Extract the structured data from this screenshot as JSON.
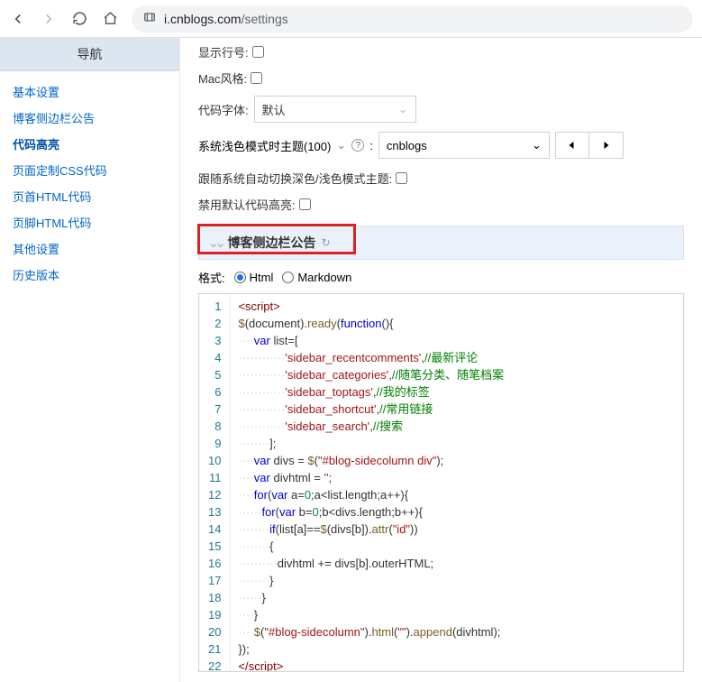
{
  "browser": {
    "host": "i.cnblogs.com",
    "path": "/settings"
  },
  "sidebar": {
    "header": "导航",
    "items": [
      {
        "label": "基本设置",
        "active": false
      },
      {
        "label": "博客侧边栏公告",
        "active": false
      },
      {
        "label": "代码高亮",
        "active": true
      },
      {
        "label": "页面定制CSS代码",
        "active": false
      },
      {
        "label": "页首HTML代码",
        "active": false
      },
      {
        "label": "页脚HTML代码",
        "active": false
      },
      {
        "label": "其他设置",
        "active": false
      },
      {
        "label": "历史版本",
        "active": false
      }
    ]
  },
  "settings": {
    "show_line_no": "显示行号:",
    "mac_style": "Mac风格:",
    "code_font": "代码字体:",
    "code_font_value": "默认",
    "theme_label": "系统浅色模式时主题(100)",
    "theme_value": "cnblogs",
    "follow_system": "跟随系统自动切换深色/浅色模式主题:",
    "disable_default_highlight": "禁用默认代码高亮:"
  },
  "section": {
    "title": "博客侧边栏公告"
  },
  "format": {
    "label": "格式:",
    "html": "Html",
    "markdown": "Markdown",
    "selected": "html"
  },
  "code": {
    "line_count": 22,
    "tokens": [
      [
        {
          "c": "tag",
          "t": "<script>"
        }
      ],
      [
        {
          "c": "fn",
          "t": "$"
        },
        {
          "c": "pun",
          "t": "("
        },
        {
          "c": "pun",
          "t": "document"
        },
        {
          "c": "pun",
          "t": ")."
        },
        {
          "c": "fn",
          "t": "ready"
        },
        {
          "c": "pun",
          "t": "("
        },
        {
          "c": "kw",
          "t": "function"
        },
        {
          "c": "pun",
          "t": "(){"
        }
      ],
      [
        {
          "c": "ws",
          "t": "····"
        },
        {
          "c": "kw",
          "t": "var"
        },
        {
          "c": "pun",
          "t": " list=["
        }
      ],
      [
        {
          "c": "ws",
          "t": "············"
        },
        {
          "c": "str",
          "t": "'sidebar_recentcomments'"
        },
        {
          "c": "pun",
          "t": ","
        },
        {
          "c": "cm",
          "t": "//最新评论"
        }
      ],
      [
        {
          "c": "ws",
          "t": "············"
        },
        {
          "c": "str",
          "t": "'sidebar_categories'"
        },
        {
          "c": "pun",
          "t": ","
        },
        {
          "c": "cm",
          "t": "//随笔分类、随笔档案"
        }
      ],
      [
        {
          "c": "ws",
          "t": "············"
        },
        {
          "c": "str",
          "t": "'sidebar_toptags'"
        },
        {
          "c": "pun",
          "t": ","
        },
        {
          "c": "cm",
          "t": "//我的标签"
        }
      ],
      [
        {
          "c": "ws",
          "t": "············"
        },
        {
          "c": "str",
          "t": "'sidebar_shortcut'"
        },
        {
          "c": "pun",
          "t": ","
        },
        {
          "c": "cm",
          "t": "//常用链接"
        }
      ],
      [
        {
          "c": "ws",
          "t": "············"
        },
        {
          "c": "str",
          "t": "'sidebar_search'"
        },
        {
          "c": "pun",
          "t": ","
        },
        {
          "c": "cm",
          "t": "//搜索"
        }
      ],
      [
        {
          "c": "ws",
          "t": "········"
        },
        {
          "c": "pun",
          "t": "];"
        }
      ],
      [
        {
          "c": "ws",
          "t": "····"
        },
        {
          "c": "kw",
          "t": "var"
        },
        {
          "c": "pun",
          "t": " divs = "
        },
        {
          "c": "fn",
          "t": "$"
        },
        {
          "c": "pun",
          "t": "("
        },
        {
          "c": "str",
          "t": "\"#blog-sidecolumn div\""
        },
        {
          "c": "pun",
          "t": ");"
        }
      ],
      [
        {
          "c": "ws",
          "t": "····"
        },
        {
          "c": "kw",
          "t": "var"
        },
        {
          "c": "pun",
          "t": " divhtml = "
        },
        {
          "c": "str",
          "t": "''"
        },
        {
          "c": "pun",
          "t": ";"
        }
      ],
      [
        {
          "c": "ws",
          "t": "····"
        },
        {
          "c": "kw",
          "t": "for"
        },
        {
          "c": "pun",
          "t": "("
        },
        {
          "c": "kw",
          "t": "var"
        },
        {
          "c": "pun",
          "t": " a="
        },
        {
          "c": "num",
          "t": "0"
        },
        {
          "c": "pun",
          "t": ";a<list.length;a++){"
        }
      ],
      [
        {
          "c": "ws",
          "t": "······"
        },
        {
          "c": "kw",
          "t": "for"
        },
        {
          "c": "pun",
          "t": "("
        },
        {
          "c": "kw",
          "t": "var"
        },
        {
          "c": "pun",
          "t": " b="
        },
        {
          "c": "num",
          "t": "0"
        },
        {
          "c": "pun",
          "t": ";b<divs.length;b++){"
        }
      ],
      [
        {
          "c": "ws",
          "t": "········"
        },
        {
          "c": "kw",
          "t": "if"
        },
        {
          "c": "pun",
          "t": "(list[a]=="
        },
        {
          "c": "fn",
          "t": "$"
        },
        {
          "c": "pun",
          "t": "(divs[b])."
        },
        {
          "c": "fn",
          "t": "attr"
        },
        {
          "c": "pun",
          "t": "("
        },
        {
          "c": "str",
          "t": "\"id\""
        },
        {
          "c": "pun",
          "t": "))"
        }
      ],
      [
        {
          "c": "ws",
          "t": "········"
        },
        {
          "c": "pun",
          "t": "{"
        }
      ],
      [
        {
          "c": "ws",
          "t": "··········"
        },
        {
          "c": "pun",
          "t": "divhtml += divs[b].outerHTML;"
        }
      ],
      [
        {
          "c": "ws",
          "t": "········"
        },
        {
          "c": "pun",
          "t": "}"
        }
      ],
      [
        {
          "c": "ws",
          "t": "······"
        },
        {
          "c": "pun",
          "t": "}"
        }
      ],
      [
        {
          "c": "ws",
          "t": "····"
        },
        {
          "c": "pun",
          "t": "}"
        }
      ],
      [
        {
          "c": "ws",
          "t": "····"
        },
        {
          "c": "fn",
          "t": "$"
        },
        {
          "c": "pun",
          "t": "("
        },
        {
          "c": "str",
          "t": "\"#blog-sidecolumn\""
        },
        {
          "c": "pun",
          "t": ")."
        },
        {
          "c": "fn",
          "t": "html"
        },
        {
          "c": "pun",
          "t": "("
        },
        {
          "c": "str",
          "t": "\"\""
        },
        {
          "c": "pun",
          "t": ")."
        },
        {
          "c": "fn",
          "t": "append"
        },
        {
          "c": "pun",
          "t": "(divhtml);"
        }
      ],
      [
        {
          "c": "pun",
          "t": "});"
        }
      ],
      [
        {
          "c": "tag",
          "t": "</"
        },
        {
          "c": "tag",
          "t": "script>"
        }
      ]
    ]
  }
}
